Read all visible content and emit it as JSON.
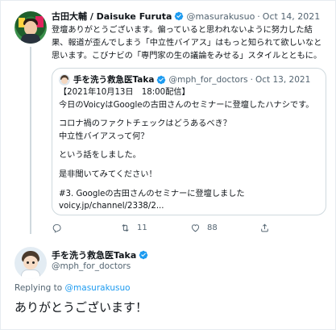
{
  "tweet": {
    "author_name": "古田大輔 / Daisuke Furuta",
    "author_handle": "@masurakusuo",
    "separator": "·",
    "date": "Oct 14, 2021",
    "text": "登壇ありがとうございます。偏っていると思われないように努力した結果、報道が歪んでしまう「中立性バイアス」はもっと知られて欲しいなと思います。こびナビの「専門家の生の議論をみせる」スタイルとともに。"
  },
  "quoted_tweet": {
    "author_name": "手を洗う救急医Taka",
    "author_handle": "@mph_for_doctors",
    "separator": "·",
    "date": "Oct 13, 2021",
    "lines": [
      "【2021年10月13日　18:00配信】",
      "今日のVoicyはGoogleの古田さんのセミナーに登壇したハナシです。",
      "",
      "コロナ禍のファクトチェックはどうあるべき？",
      "中立性バイアスって何？",
      "",
      "という話をしました。",
      "",
      "是非聞いてみてください！",
      "",
      "#3. Googleの古田さんのセミナーに登壇しました",
      "voicy.jp/channel/2338/2..."
    ]
  },
  "actions": {
    "reply_count": "",
    "retweet_count": "11",
    "like_count": "88"
  },
  "reply": {
    "author_name": "手を洗う救急医Taka",
    "author_handle": "@mph_for_doctors",
    "replying_to_prefix": "Replying to",
    "replying_to_handle": "@masurakusuo",
    "text": "ありがとうございます！"
  },
  "colors": {
    "accent": "#1d9bf0",
    "text": "#0f1419",
    "muted": "#536471",
    "border": "#cfd9de"
  }
}
